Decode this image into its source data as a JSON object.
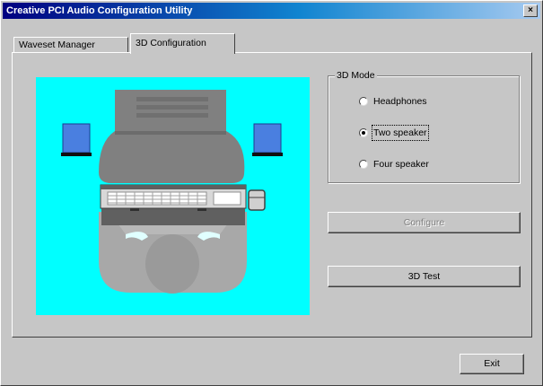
{
  "window": {
    "title": "Creative PCI Audio Configuration Utility",
    "close_glyph": "×"
  },
  "tabs": [
    {
      "label": "Waveset Manager",
      "active": false
    },
    {
      "label": "3D Configuration",
      "active": true
    }
  ],
  "mode_group": {
    "label": "3D Mode",
    "options": [
      {
        "label": "Headphones",
        "selected": false
      },
      {
        "label": "Two speaker",
        "selected": true
      },
      {
        "label": "Four speaker",
        "selected": false
      }
    ]
  },
  "buttons": {
    "configure": "Configure",
    "test_3d": "3D Test",
    "exit": "Exit"
  },
  "colors": {
    "illustration_bg": "#00ffff",
    "speaker": "#4a7fe0",
    "monitor": "#808080"
  }
}
